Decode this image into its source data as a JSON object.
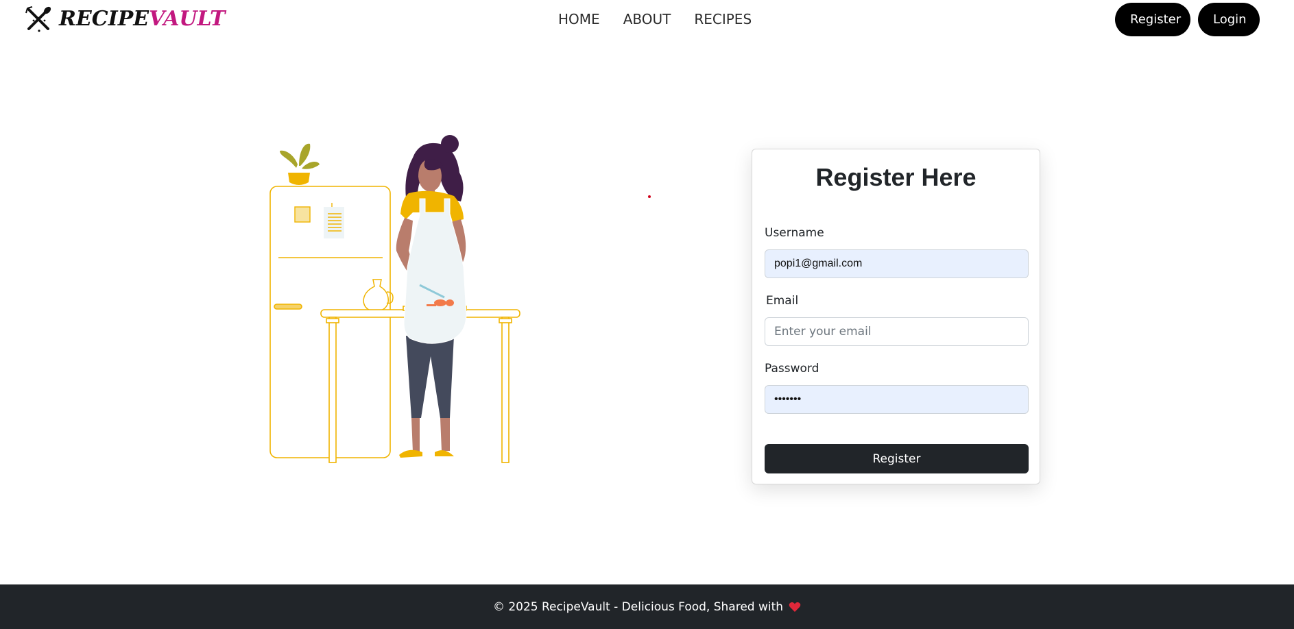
{
  "brand": {
    "part1": "RECIPE",
    "part2": "VAULT"
  },
  "nav": {
    "items": [
      "HOME",
      "ABOUT",
      "RECIPES"
    ]
  },
  "auth": {
    "register_label": "Register",
    "login_label": "Login"
  },
  "form": {
    "title": "Register Here",
    "username": {
      "label": "Username",
      "value": "popi1@gmail.com"
    },
    "email": {
      "label": "Email",
      "placeholder": "Enter your email",
      "value": ""
    },
    "password": {
      "label": "Password",
      "value": "•••••••"
    },
    "submit_label": "Register"
  },
  "footer": {
    "text": "© 2025 RecipeVault - Delicious Food, Shared with",
    "heart_icon": "heart-icon"
  },
  "colors": {
    "accent": "#c2187f",
    "dark": "#212529",
    "autofill": "#e8f0fe",
    "illustration": "#f0b400"
  }
}
